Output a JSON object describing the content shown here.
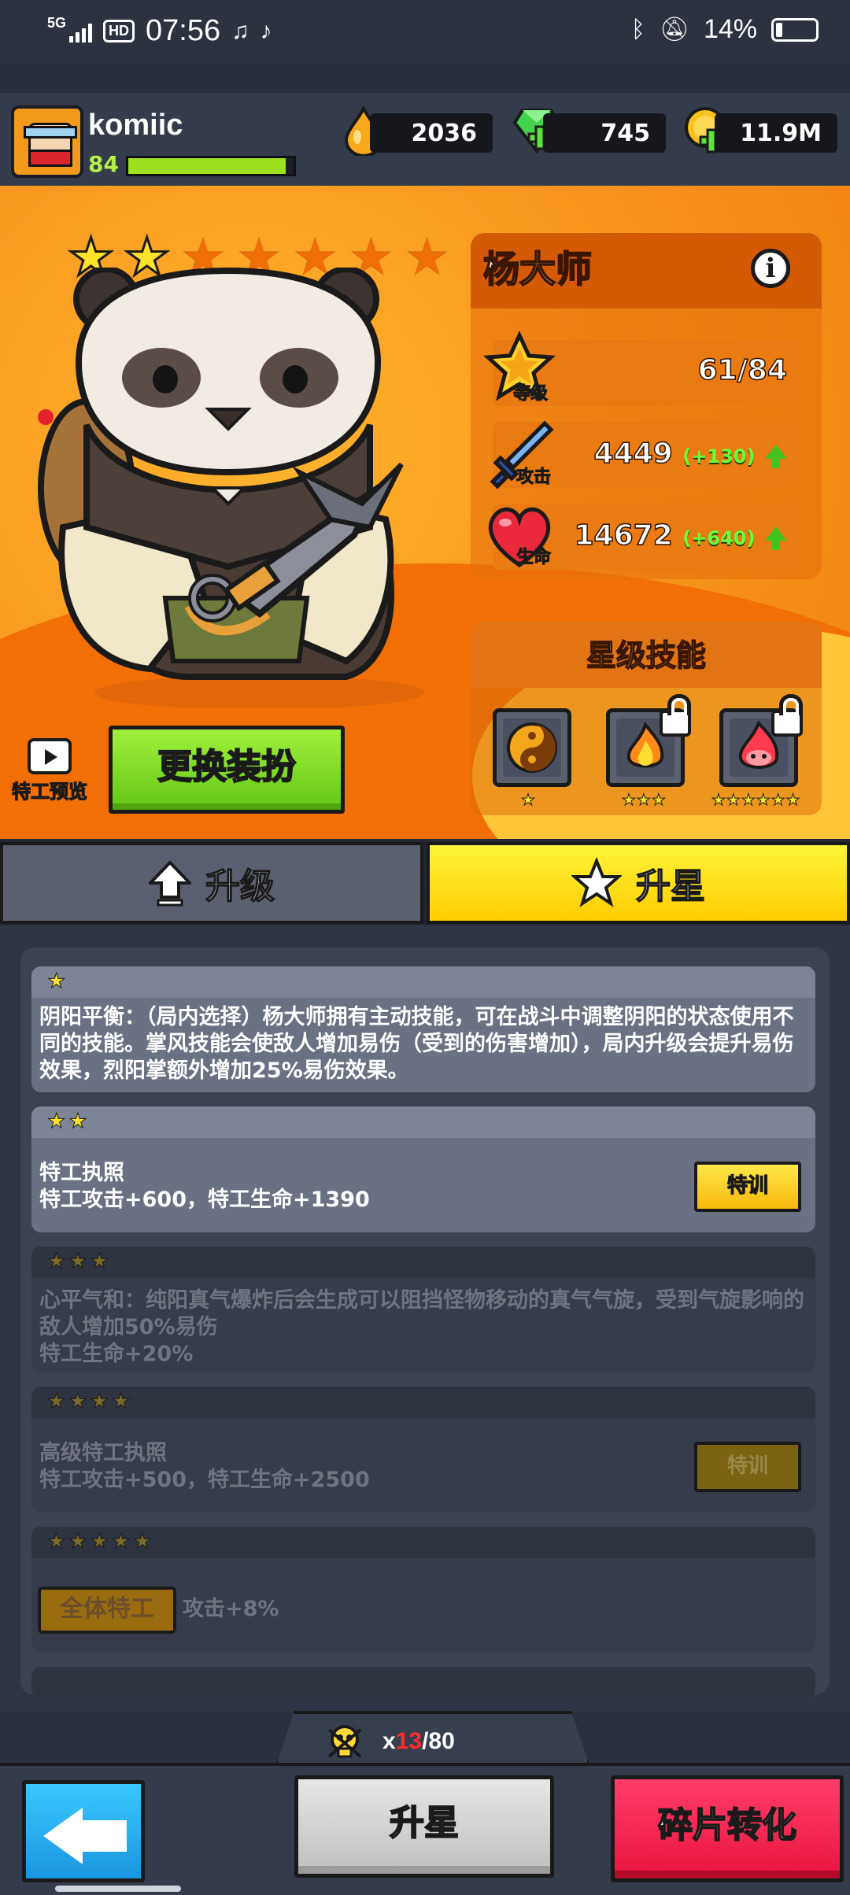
{
  "status": {
    "network": "5G",
    "hd": "HD",
    "time": "07:56",
    "battery": "14%",
    "icons": [
      "signal-icon",
      "hd-icon",
      "music-listen-icon",
      "tiktok-icon",
      "bluetooth-icon",
      "mute-icon",
      "battery-icon"
    ]
  },
  "player": {
    "name": "komiic",
    "level": "84",
    "xp_fraction": 0.95
  },
  "resources": {
    "oil": "2036",
    "gems": "745",
    "coins": "11.9M"
  },
  "hero": {
    "name": "杨大师",
    "stars_on": 2,
    "stars_total": 7,
    "level_label": "等级",
    "level_value": "61/84",
    "attack_label": "攻击",
    "attack_value": "4449",
    "attack_bonus": "(+130)",
    "hp_label": "生命",
    "hp_value": "14672",
    "hp_bonus": "(+640)"
  },
  "skills": {
    "title": "星级技能",
    "items": [
      {
        "icon": "yin-yang-icon",
        "stars": "★",
        "locked": false
      },
      {
        "icon": "fire-spirit-icon",
        "stars": "★★★",
        "locked": true
      },
      {
        "icon": "flame-demon-icon",
        "stars": "★★★★★★",
        "locked": true
      }
    ]
  },
  "actions": {
    "preview_label": "特工预览",
    "change_outfit": "更换装扮"
  },
  "tabs": {
    "upgrade": "升级",
    "star_up": "升星"
  },
  "star_cards": [
    {
      "stars": "★",
      "text": "阴阳平衡：（局内选择）杨大师拥有主动技能，可在战斗中调整阴阳的状态使用不同的技能。掌风技能会使敌人增加易伤（受到的伤害增加），局内升级会提升易伤效果，烈阳掌额外增加25%易伤效果。"
    },
    {
      "stars": "★★",
      "line1": "特工执照",
      "line2": "特工攻击+600，特工生命+1390",
      "button": "特训"
    },
    {
      "stars": "★★★",
      "text": "心平气和：纯阳真气爆炸后会生成可以阻挡怪物移动的真气气旋，受到气旋影响的敌人增加50%易伤",
      "line2": "特工生命+20%"
    },
    {
      "stars": "★★★★",
      "line1": "高级特工执照",
      "line2": "特工攻击+500，特工生命+2500",
      "button": "特训"
    },
    {
      "stars": "★★★★★",
      "badge": "全体特工",
      "text": "攻击+8%"
    }
  ],
  "bottom": {
    "shard_prefix": "x",
    "shard_current": "13",
    "shard_total": "/80",
    "star_up_button": "升星",
    "convert_button": "碎片转化"
  }
}
